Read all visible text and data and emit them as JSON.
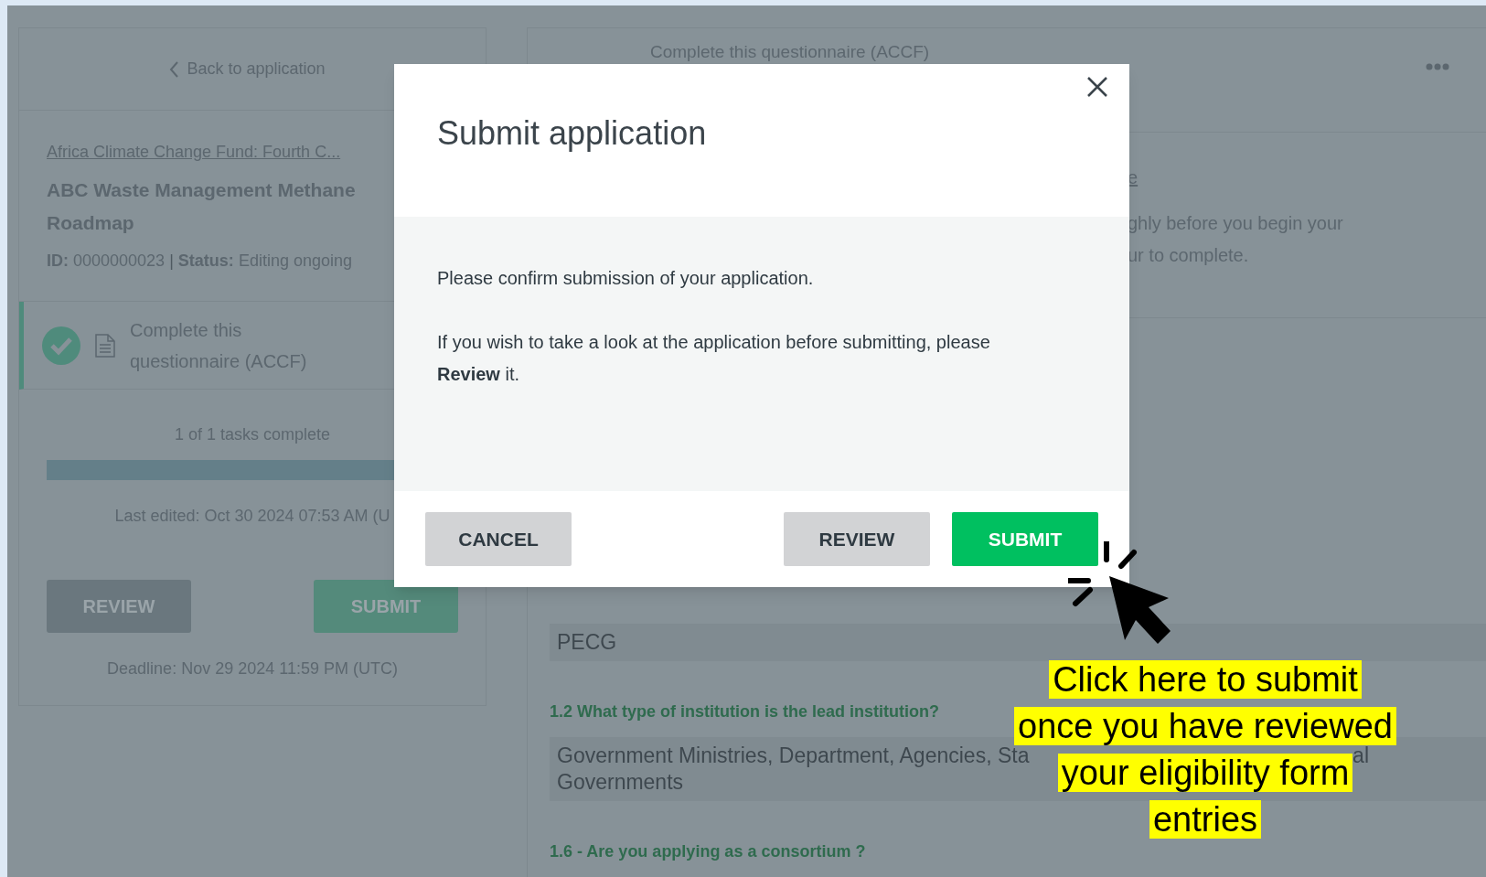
{
  "sidebar": {
    "back_link": "Back to application",
    "fund_link": "Africa Climate Change Fund: Fourth C...",
    "application_title": "ABC Waste Management Methane Roadmap",
    "id_label": "ID:",
    "id_value": "0000000023",
    "separator": "|",
    "status_label": "Status:",
    "status_value": "Editing ongoing",
    "tasks": [
      {
        "label": "Complete this questionnaire (ACCF)",
        "completed": true,
        "selected": true
      }
    ],
    "progress_text": "1 of 1 tasks complete",
    "progress": {
      "level": 1
    },
    "last_edited": "Last edited: Oct 30 2024 07:53 AM (U",
    "buttons": [
      {
        "kind": "secondary",
        "label": "REVIEW"
      },
      {
        "kind": "primary",
        "label": "SUBMIT"
      }
    ],
    "deadline": "Deadline: Nov 29 2024 11:59 PM (UTC)"
  },
  "main": {
    "title": "Complete this questionnaire (ACCF)",
    "intro_link_fragment": "e",
    "intro_lines": [
      "ghly before you begin your",
      "ur to complete."
    ],
    "fields": [
      {
        "kind": "answer",
        "value": "PECG"
      },
      {
        "kind": "question",
        "text": "1.2 What type of institution is the lead institution?"
      },
      {
        "kind": "answer",
        "value": "Government Ministries, Department, Agencies, Sta",
        "value_end": "al",
        "value_line2": "Governments"
      },
      {
        "kind": "question",
        "text": "1.6 - Are you applying as a consortium ?"
      }
    ]
  },
  "dialog": {
    "title": "Submit application",
    "paragraphs": [
      "Please confirm submission of your application.",
      "If you wish to take a look at the application before submitting, please **Review** it."
    ],
    "buttons": [
      {
        "kind": "secondary",
        "label": "CANCEL"
      },
      {
        "kind": "secondary",
        "label": "REVIEW"
      },
      {
        "kind": "primary",
        "label": "SUBMIT"
      }
    ]
  },
  "annotation": {
    "lines": [
      "Click here to submit",
      "once you have reviewed",
      "your eligibility form",
      "entries"
    ]
  }
}
